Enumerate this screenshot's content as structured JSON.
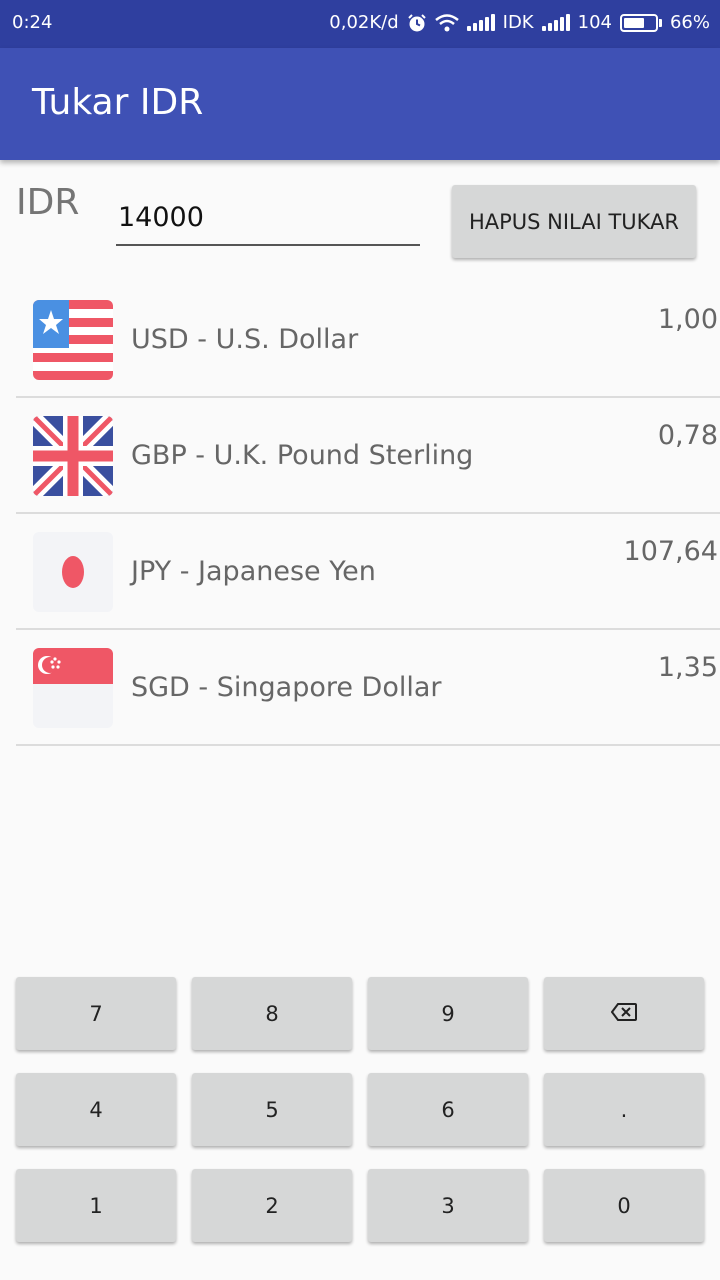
{
  "status_bar": {
    "time": "0:24",
    "speed": "0,02K/d",
    "carrier": "IDK",
    "signal2_label": "104",
    "battery": "66%",
    "battery_level": 0.66
  },
  "app_bar": {
    "title": "Tukar IDR"
  },
  "input": {
    "currency_label": "IDR",
    "value": "14000"
  },
  "clear_button": {
    "label": "HAPUS NILAI TUKAR"
  },
  "currencies": [
    {
      "name": "USD - U.S. Dollar",
      "rate": "1,00",
      "flag_icon": "us-flag-icon"
    },
    {
      "name": "GBP - U.K. Pound Sterling",
      "rate": "0,78",
      "flag_icon": "uk-flag-icon"
    },
    {
      "name": "JPY - Japanese Yen",
      "rate": "107,64",
      "flag_icon": "japan-flag-icon"
    },
    {
      "name": "SGD - Singapore Dollar",
      "rate": "1,35",
      "flag_icon": "singapore-flag-icon"
    }
  ],
  "keypad": {
    "keys": [
      "7",
      "8",
      "9",
      "⌫",
      "4",
      "5",
      "6",
      ".",
      "1",
      "2",
      "3",
      "0"
    ]
  },
  "colors": {
    "status_bar": "#2f3f9f",
    "app_bar": "#3f51b5",
    "button": "#d6d7d7",
    "flag_red": "#ef5766",
    "flag_blue": "#4a90e2",
    "uk_blue": "#3a4f9f"
  }
}
